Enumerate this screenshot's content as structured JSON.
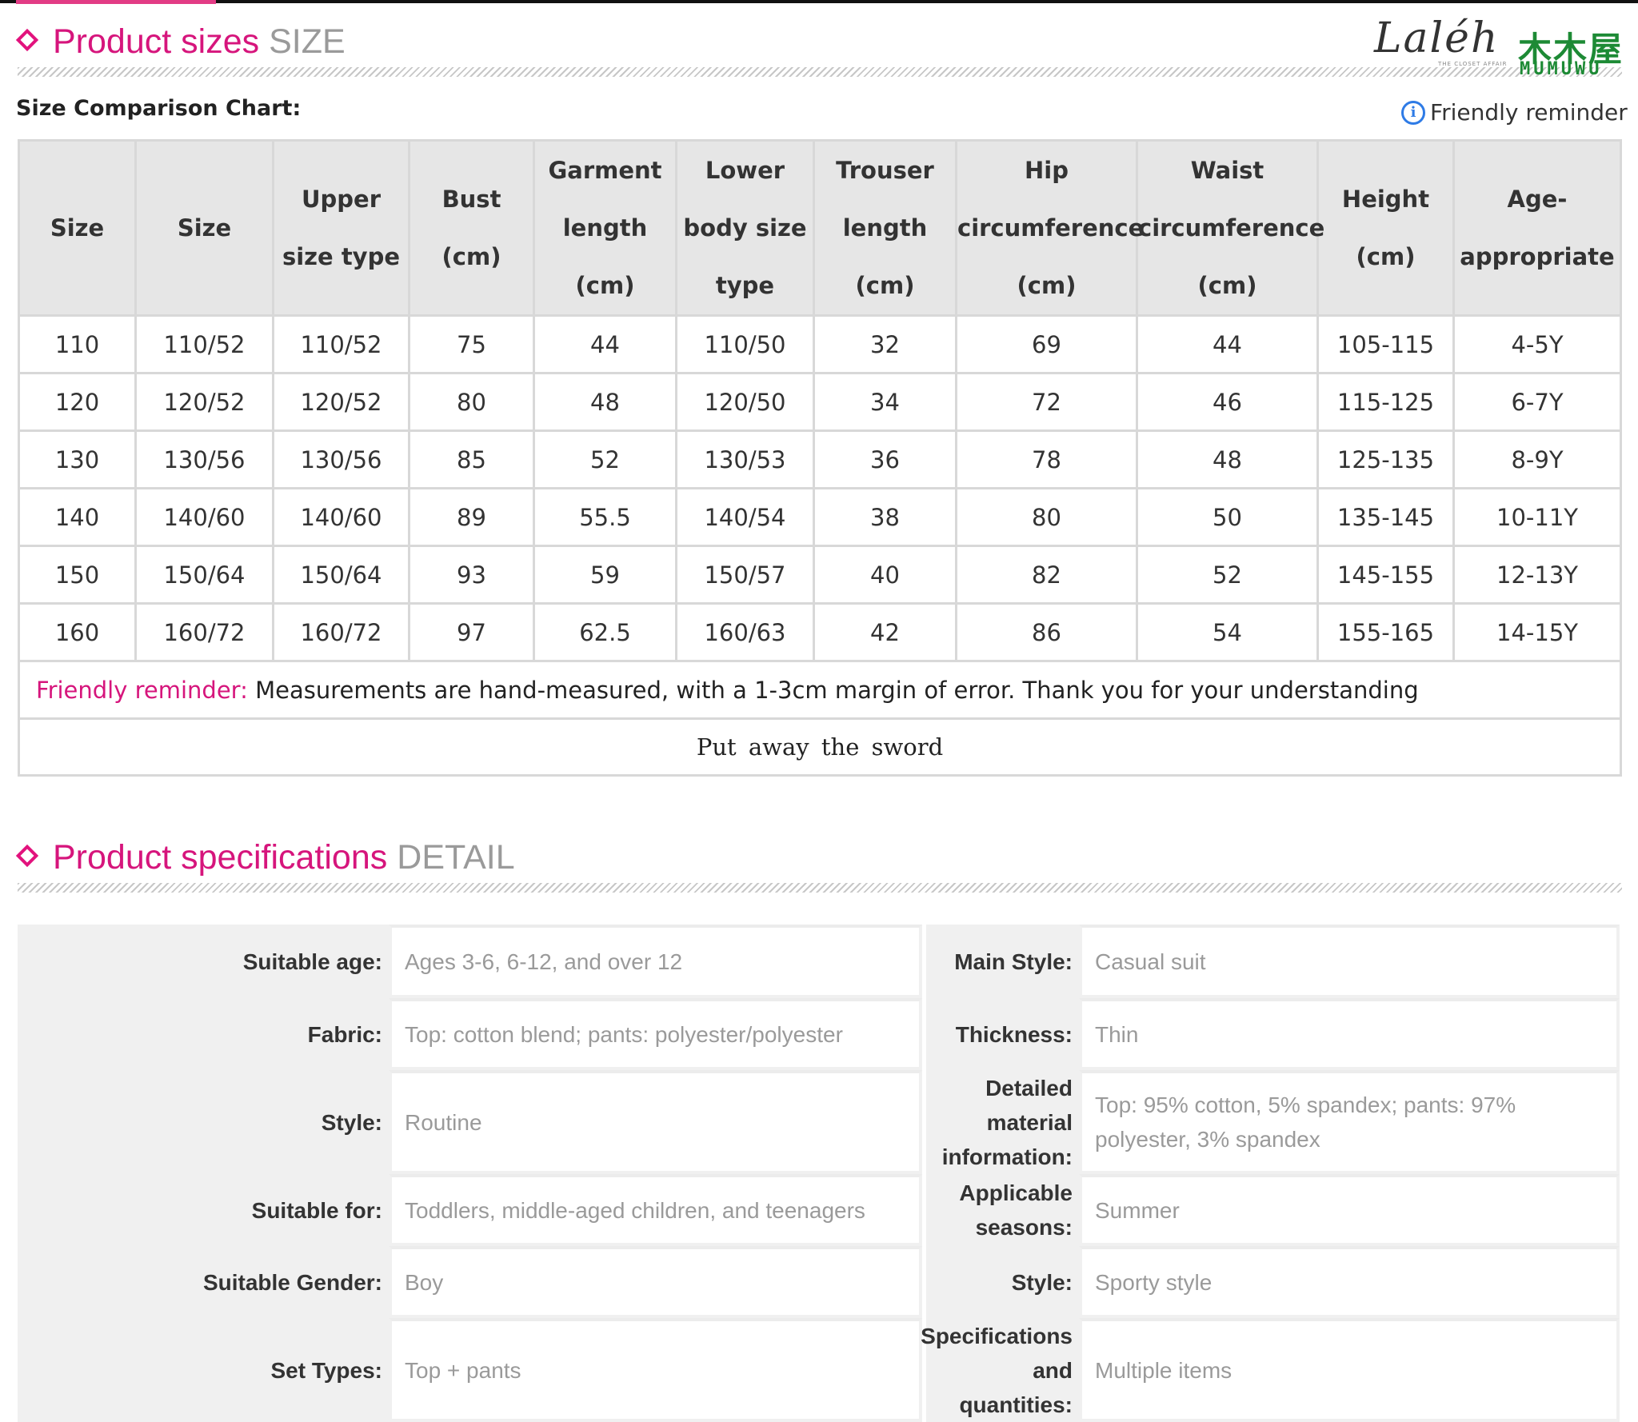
{
  "logo": {
    "script": "Laléh",
    "tagline": "THE CLOSET AFFAIR",
    "cn": "木木屋",
    "en": "MUMUWU"
  },
  "section1": {
    "title": "Product sizes",
    "title_en": "SIZE"
  },
  "chart_label": "Size Comparison Chart:",
  "reminder_top": "Friendly reminder",
  "size_table": {
    "headers": [
      "Size",
      "Size",
      "Upper size type",
      "Bust (cm)",
      "Garment length (cm)",
      "Lower body size type",
      "Trouser length (cm)",
      "Hip circumference (cm)",
      "Waist circumference (cm)",
      "Height (cm)",
      "Age-appropriate"
    ],
    "rows": [
      [
        "110",
        "110/52",
        "110/52",
        "75",
        "44",
        "110/50",
        "32",
        "69",
        "44",
        "105-115",
        "4-5Y"
      ],
      [
        "120",
        "120/52",
        "120/52",
        "80",
        "48",
        "120/50",
        "34",
        "72",
        "46",
        "115-125",
        "6-7Y"
      ],
      [
        "130",
        "130/56",
        "130/56",
        "85",
        "52",
        "130/53",
        "36",
        "78",
        "48",
        "125-135",
        "8-9Y"
      ],
      [
        "140",
        "140/60",
        "140/60",
        "89",
        "55.5",
        "140/54",
        "38",
        "80",
        "50",
        "135-145",
        "10-11Y"
      ],
      [
        "150",
        "150/64",
        "150/64",
        "93",
        "59",
        "150/57",
        "40",
        "82",
        "52",
        "145-155",
        "12-13Y"
      ],
      [
        "160",
        "160/72",
        "160/72",
        "97",
        "62.5",
        "160/63",
        "42",
        "86",
        "54",
        "155-165",
        "14-15Y"
      ]
    ],
    "note_label": "Friendly reminder:",
    "note_text": " Measurements are hand-measured, with a 1-3cm margin of error. Thank you for your understanding",
    "footer": "Put away the sword"
  },
  "section2": {
    "title": "Product specifications",
    "title_en": "DETAIL"
  },
  "specs": {
    "left": [
      {
        "label": "Suitable age:",
        "value": "Ages 3-6, 6-12, and over 12"
      },
      {
        "label": "Fabric:",
        "value": "Top: cotton blend; pants: polyester/polyester"
      },
      {
        "label": "Style:",
        "value": "Routine"
      },
      {
        "label": "Suitable for:",
        "value": "Toddlers, middle-aged children, and teenagers"
      },
      {
        "label": "Suitable Gender:",
        "value": "Boy"
      },
      {
        "label": "Set Types:",
        "value": "Top + pants"
      }
    ],
    "right": [
      {
        "label": "Main Style:",
        "value": "Casual suit"
      },
      {
        "label": "Thickness:",
        "value": "Thin"
      },
      {
        "label": "Detailed material information:",
        "value": "Top: 95% cotton, 5% spandex; pants: 97% polyester, 3% spandex"
      },
      {
        "label": "Applicable seasons:",
        "value": "Summer"
      },
      {
        "label": "Style:",
        "value": "Sporty style"
      },
      {
        "label": "Specifications and quantities:",
        "value": "Multiple items"
      }
    ]
  },
  "colors": {
    "accent": "#d6157c",
    "logo_green": "#1d8a35",
    "info_blue": "#2e7be6"
  }
}
